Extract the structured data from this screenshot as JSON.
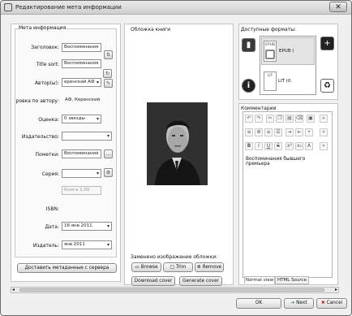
{
  "window": {
    "title": "Редактирование мета информации",
    "close_glyph": "✕"
  },
  "meta": {
    "group_title": "Мета информация",
    "fields": {
      "title": {
        "label": "Заголовок:",
        "value": "Воспоминания"
      },
      "title_sort": {
        "label": "Title sort:",
        "value": "Воспоминания"
      },
      "authors": {
        "label": "Автор(ы):",
        "value": "еренский АФ"
      },
      "author_sort": {
        "label": "ровка по автору:",
        "value": "АФ, Керенский"
      },
      "rating": {
        "label": "Оценка:",
        "value": "0 звезды"
      },
      "publisher": {
        "label": "Издательство:",
        "value": ""
      },
      "tags": {
        "label": "Пометки:",
        "value": "Воспоминания"
      },
      "series": {
        "label": "Серия:",
        "value": ""
      },
      "series_index": {
        "value": "Книга 1,00"
      },
      "isbn": {
        "label": "ISBN:",
        "value": ""
      },
      "date": {
        "label": "Дата:",
        "value": "16 янв 2011"
      },
      "published": {
        "label": "Издатель:",
        "value": "янв 2011"
      }
    },
    "fetch_button": "Доставить метаданные с сервера"
  },
  "cover": {
    "group_title": "Обложка книги",
    "changed_label": "Заменено изображение обложки:",
    "browse": "Browse",
    "trim": "Trim",
    "remove": "Remove",
    "download": "Download cover",
    "generate": "Generate cover"
  },
  "formats": {
    "group_title": "Доступные форматы:",
    "items": [
      {
        "name": "EPUB (",
        "badge": "EPUB"
      },
      {
        "name": "LIT (0.",
        "badge": "LIT"
      }
    ]
  },
  "comments": {
    "group_title": "Комментарии",
    "text": "Воспоминания бывшего премьера",
    "tabs": [
      "Normal view",
      "HTML Source"
    ],
    "format_buttons": [
      "B",
      "I",
      "U",
      "S"
    ]
  },
  "footer": {
    "ok": "OK",
    "next": "Next",
    "cancel": "Cancel"
  }
}
